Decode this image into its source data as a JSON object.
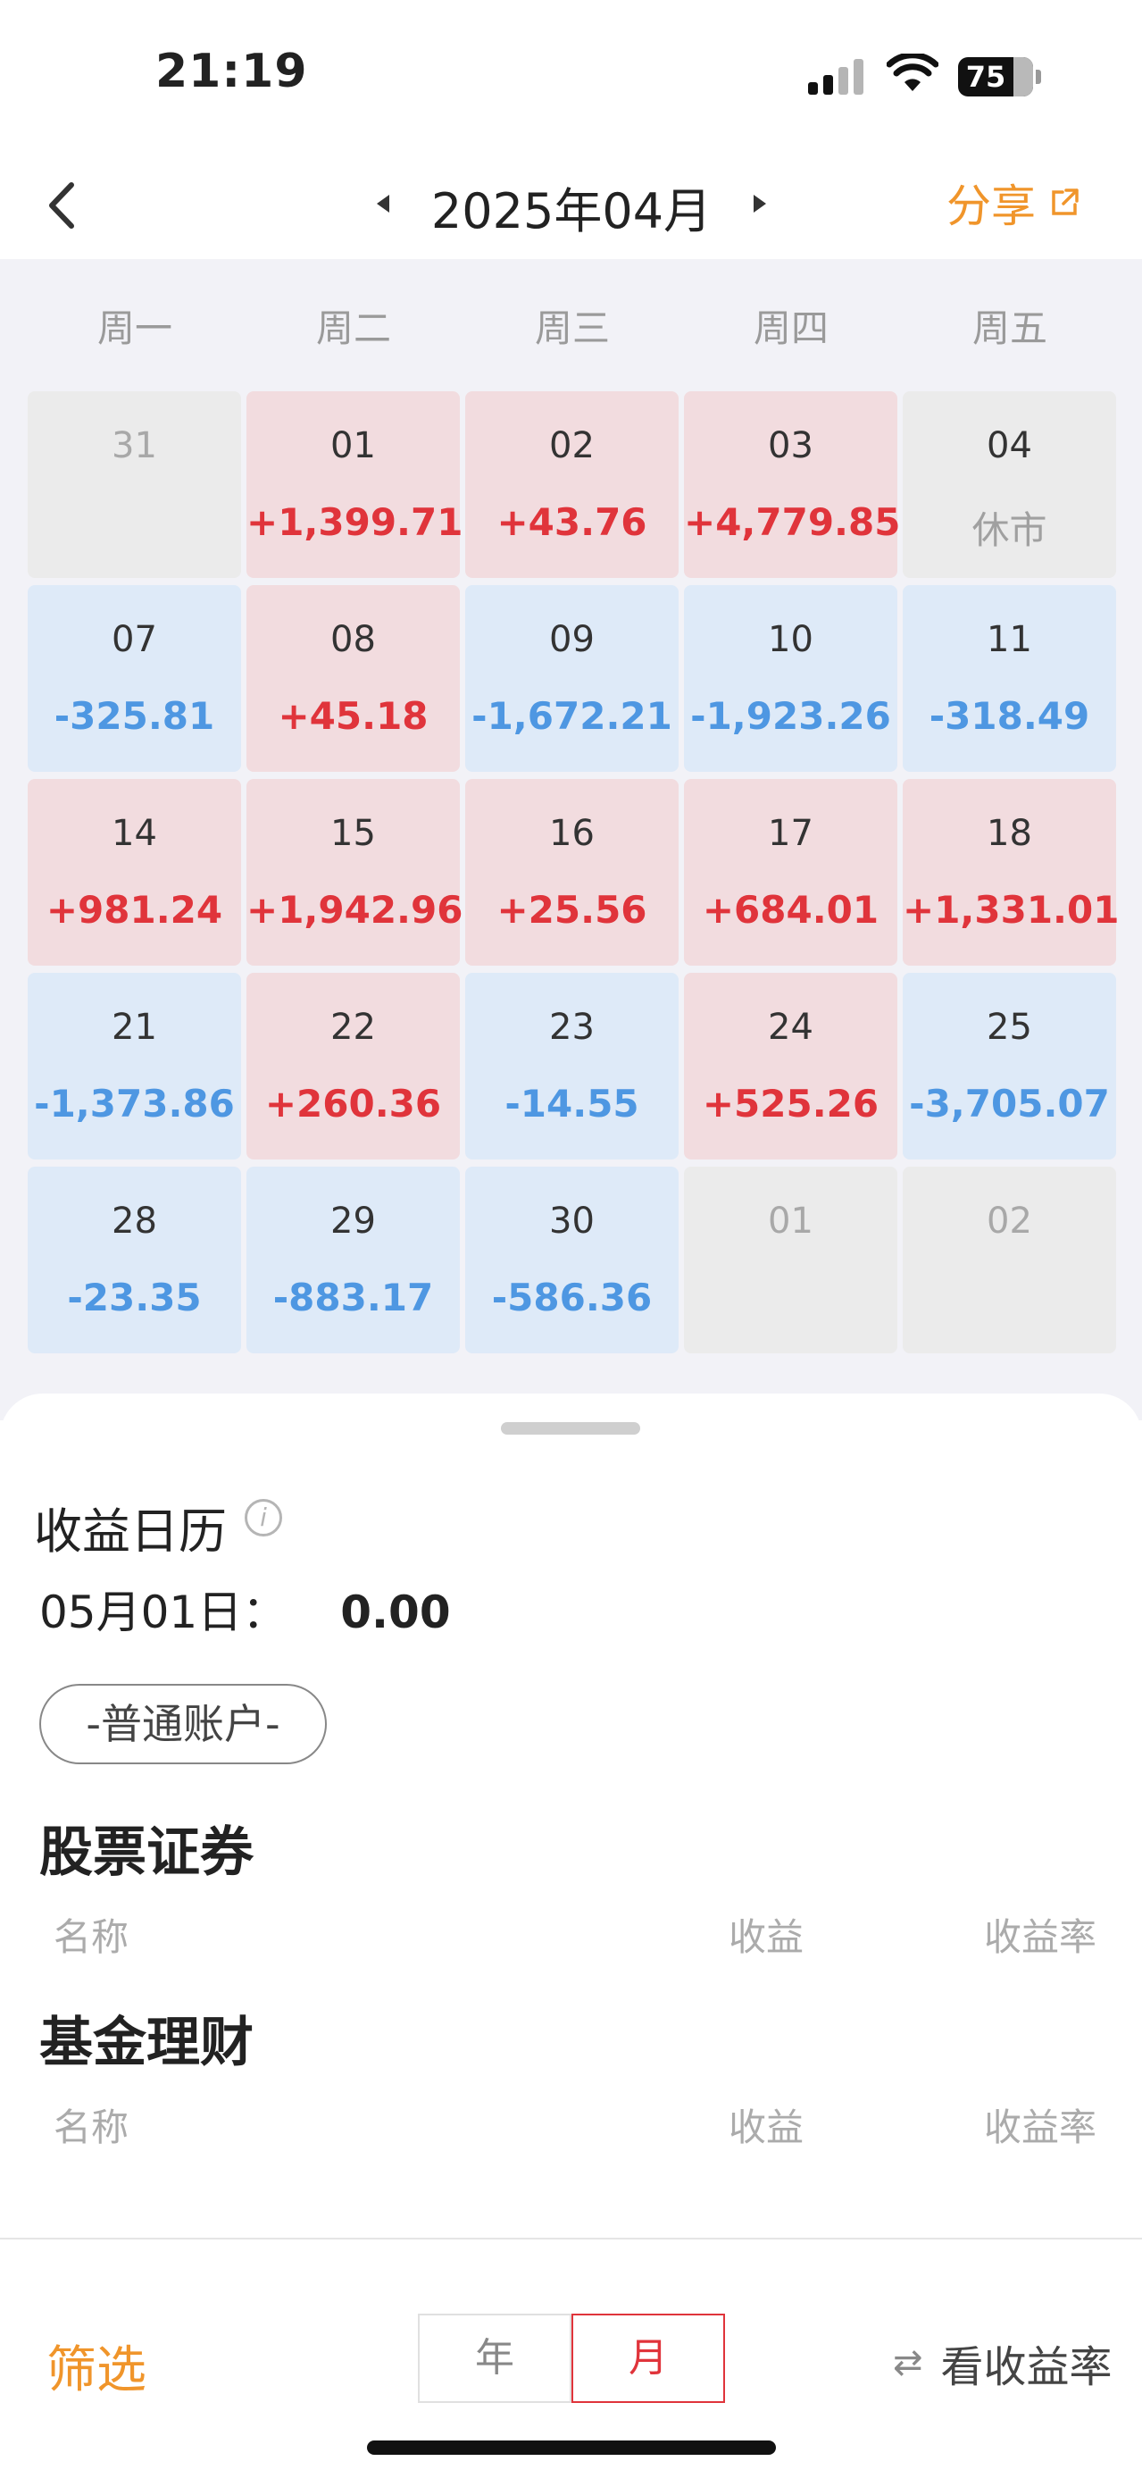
{
  "status_bar": {
    "time": "21:19",
    "battery": "75"
  },
  "header": {
    "title": "2025年04月",
    "share_label": "分享"
  },
  "weekdays": [
    "周一",
    "周二",
    "周三",
    "周四",
    "周五"
  ],
  "calendar": [
    {
      "day": "31",
      "value": "",
      "type": "neutral",
      "dim": true
    },
    {
      "day": "01",
      "value": "+1,399.71",
      "type": "gain"
    },
    {
      "day": "02",
      "value": "+43.76",
      "type": "gain"
    },
    {
      "day": "03",
      "value": "+4,779.85",
      "type": "gain"
    },
    {
      "day": "04",
      "value": "休市",
      "type": "neutral",
      "closed": true
    },
    {
      "day": "07",
      "value": "-325.81",
      "type": "loss"
    },
    {
      "day": "08",
      "value": "+45.18",
      "type": "gain"
    },
    {
      "day": "09",
      "value": "-1,672.21",
      "type": "loss"
    },
    {
      "day": "10",
      "value": "-1,923.26",
      "type": "loss"
    },
    {
      "day": "11",
      "value": "-318.49",
      "type": "loss"
    },
    {
      "day": "14",
      "value": "+981.24",
      "type": "gain"
    },
    {
      "day": "15",
      "value": "+1,942.96",
      "type": "gain"
    },
    {
      "day": "16",
      "value": "+25.56",
      "type": "gain"
    },
    {
      "day": "17",
      "value": "+684.01",
      "type": "gain"
    },
    {
      "day": "18",
      "value": "+1,331.01",
      "type": "gain"
    },
    {
      "day": "21",
      "value": "-1,373.86",
      "type": "loss"
    },
    {
      "day": "22",
      "value": "+260.36",
      "type": "gain"
    },
    {
      "day": "23",
      "value": "-14.55",
      "type": "loss"
    },
    {
      "day": "24",
      "value": "+525.26",
      "type": "gain"
    },
    {
      "day": "25",
      "value": "-3,705.07",
      "type": "loss"
    },
    {
      "day": "28",
      "value": "-23.35",
      "type": "loss"
    },
    {
      "day": "29",
      "value": "-883.17",
      "type": "loss"
    },
    {
      "day": "30",
      "value": "-586.36",
      "type": "loss"
    },
    {
      "day": "01",
      "value": "",
      "type": "neutral",
      "dim": true
    },
    {
      "day": "02",
      "value": "",
      "type": "neutral",
      "dim": true
    }
  ],
  "sheet": {
    "title": "收益日历",
    "date_label": "05月01日：",
    "date_value": "0.00",
    "account_label": "-普通账户-",
    "stocks": {
      "title": "股票证券",
      "col_name": "名称",
      "col_profit": "收益",
      "col_rate": "收益率"
    },
    "funds": {
      "title": "基金理财",
      "col_name": "名称",
      "col_profit": "收益",
      "col_rate": "收益率"
    }
  },
  "bottom_bar": {
    "filter_label": "筛选",
    "year_label": "年",
    "month_label": "月",
    "yield_label": "看收益率",
    "swap_icon": "⇄"
  },
  "colors": {
    "gain": "#e0343b",
    "loss": "#4e97e2",
    "accent": "#f0952b"
  }
}
